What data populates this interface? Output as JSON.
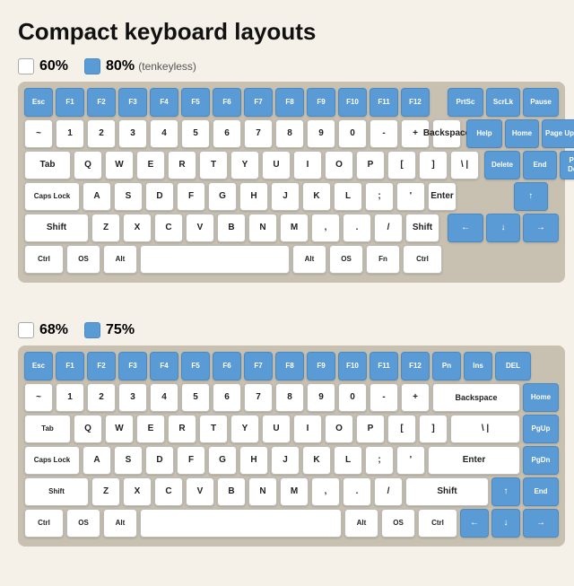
{
  "title": "Compact keyboard layouts",
  "layout1": {
    "legend_60": "60%",
    "legend_80": "80%",
    "legend_80_sub": "(tenkeyless)"
  },
  "layout2": {
    "legend_68": "68%",
    "legend_75": "75%"
  }
}
